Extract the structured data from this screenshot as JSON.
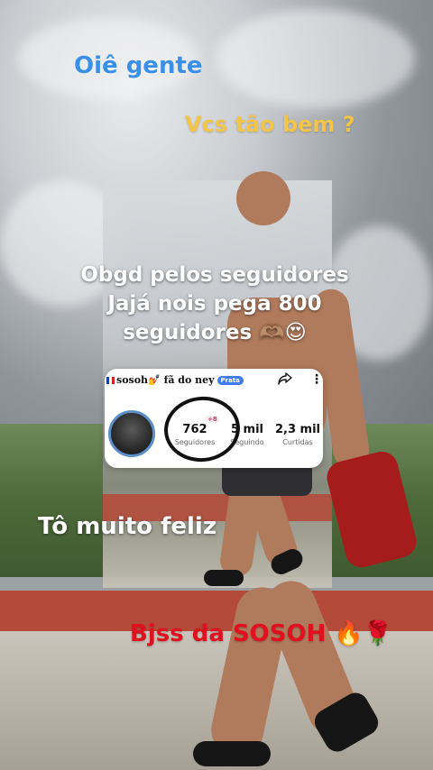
{
  "overlays": {
    "greeting": "Oiê gente",
    "question": "Vcs tão bem ?",
    "thanks_line1": "Obgd pelos seguidores",
    "thanks_line2": "Jajá nois pega 800",
    "thanks_line3": "seguidores 🫶🏽😍",
    "happy": "Tô muito feliz",
    "signoff": "Bjss da SOSOH 🔥🌹"
  },
  "profile_card": {
    "username": "sosoh💅 fã do ney",
    "badge": "Prata",
    "stats": [
      {
        "value": "762",
        "label": "Seguidores"
      },
      {
        "value": "5 mil",
        "label": "Seguindo"
      },
      {
        "value": "2,3 mil",
        "label": "Curtidas"
      }
    ],
    "new_followers_badge": "+8"
  },
  "icons": {
    "share": "share-icon",
    "more": "more-options-icon",
    "flag": "france-flag-icon"
  },
  "colors": {
    "greeting": "#3a8fe6",
    "question": "#f2c54a",
    "signoff": "#e0101e"
  }
}
